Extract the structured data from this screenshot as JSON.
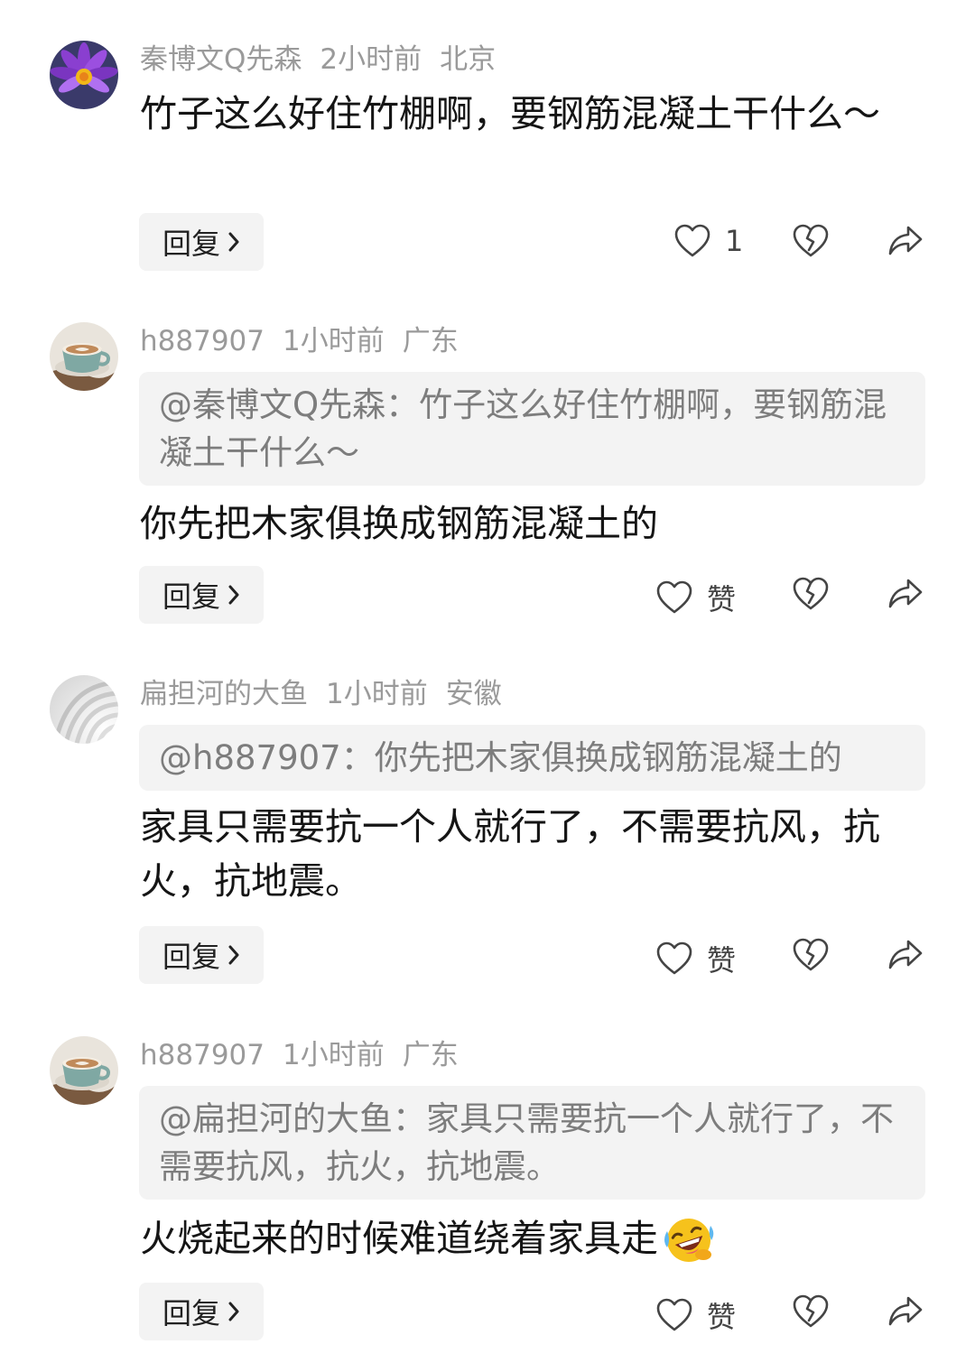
{
  "comments": [
    {
      "username": "秦博文Q先森",
      "time": "2小时前",
      "location": "北京",
      "text": "竹子这么好住竹棚啊，要钢筋混凝土干什么～",
      "reply_label": "回复",
      "like_label": "1",
      "avatar": "purple-lotus-flower"
    },
    {
      "username": "h887907",
      "time": "1小时前",
      "location": "广东",
      "quote": "@秦博文Q先森：竹子这么好住竹棚啊，要钢筋混凝土干什么～",
      "text": "你先把木家俱换成钢筋混凝土的",
      "reply_label": "回复",
      "like_label": "赞",
      "avatar": "coffee-cup"
    },
    {
      "username": "扁担河的大鱼",
      "time": "1小时前",
      "location": "安徽",
      "quote": "@h887907：你先把木家俱换成钢筋混凝土的",
      "text": "家具只需要抗一个人就行了，不需要抗风，抗火，抗地震。",
      "reply_label": "回复",
      "like_label": "赞",
      "avatar": "white-waves"
    },
    {
      "username": "h887907",
      "time": "1小时前",
      "location": "广东",
      "quote": "@扁担河的大鱼：家具只需要抗一个人就行了，不需要抗风，抗火，抗地震。",
      "text": "火烧起来的时候难道绕着家具走",
      "reply_label": "回复",
      "like_label": "赞",
      "avatar": "coffee-cup",
      "emoji": "rolling-laughing-emoji"
    }
  ],
  "icons": {
    "like": "heart-outline-icon",
    "dislike": "broken-heart-icon",
    "share": "share-arrow-icon",
    "reply_chevron": "chevron-right-icon"
  }
}
